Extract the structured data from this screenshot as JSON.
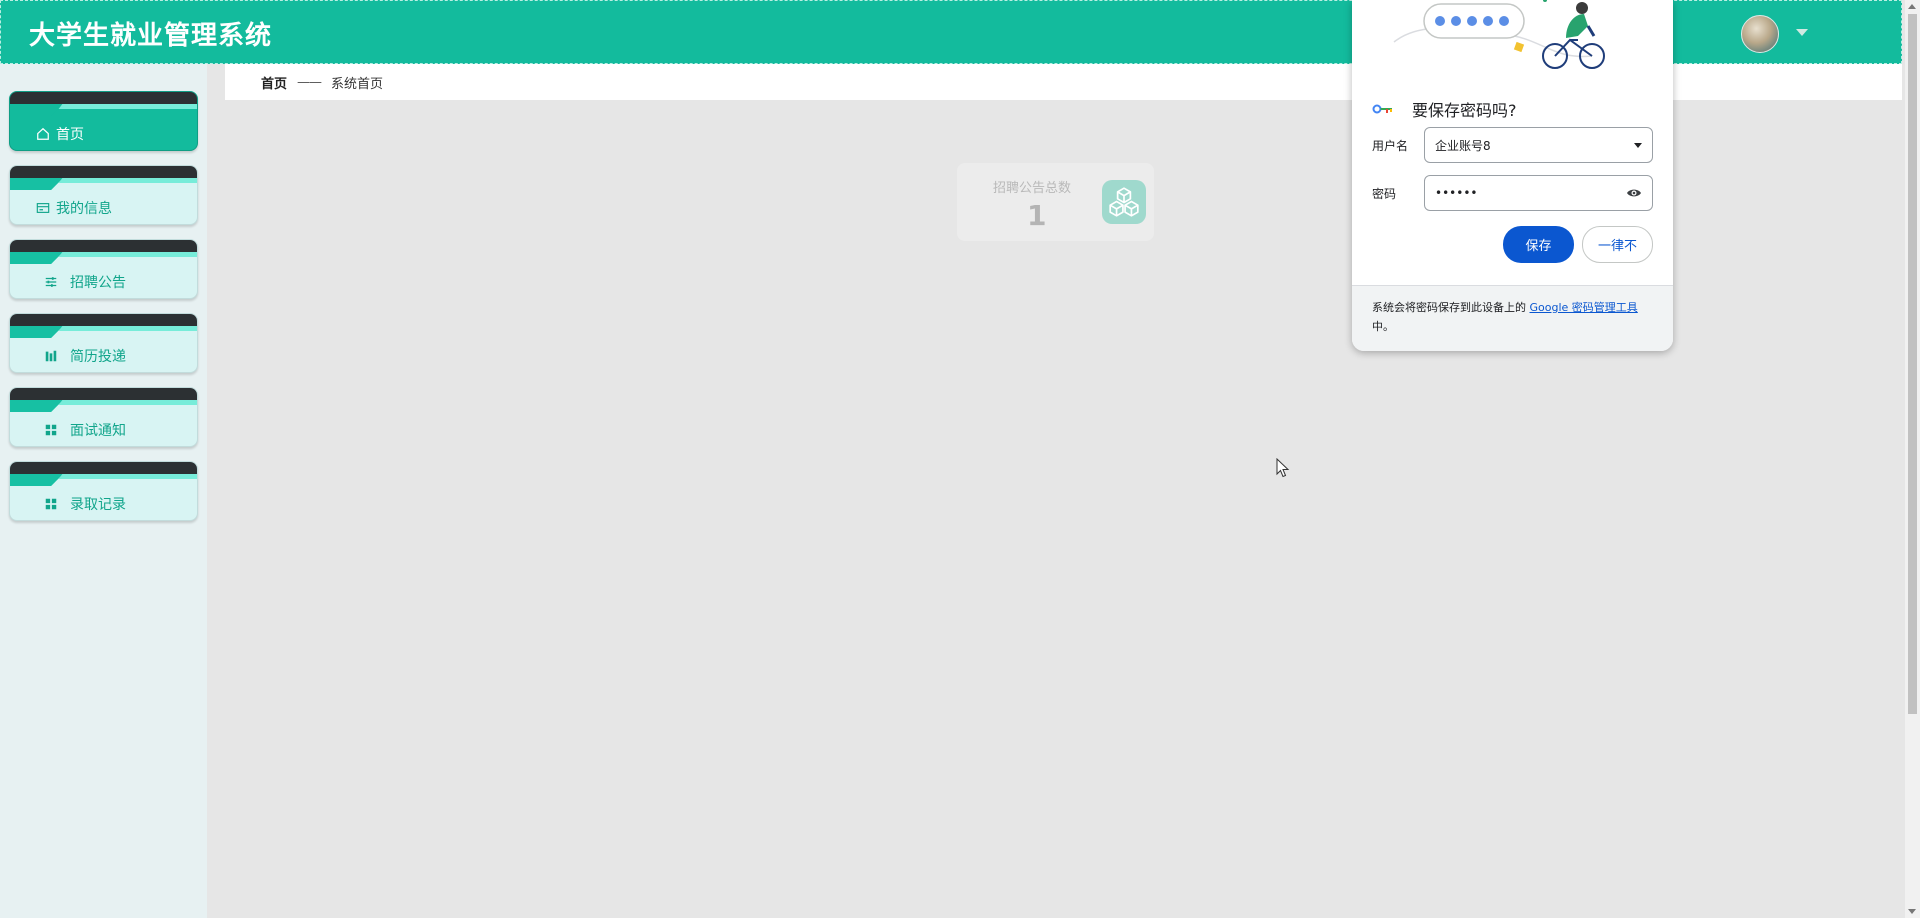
{
  "app": {
    "title": "大学生就业管理系统"
  },
  "header": {
    "avatar_icon": "user-avatar",
    "dropdown_icon": "caret-down-icon"
  },
  "sidebar": {
    "items": [
      {
        "label": "首页",
        "icon": "home-icon",
        "active": true
      },
      {
        "label": "我的信息",
        "icon": "card-icon",
        "active": false
      },
      {
        "label": "招聘公告",
        "icon": "sliders-icon",
        "active": false
      },
      {
        "label": "简历投递",
        "icon": "bar-chart-icon",
        "active": false
      },
      {
        "label": "面试通知",
        "icon": "grid-icon",
        "active": false
      },
      {
        "label": "录取记录",
        "icon": "grid-icon",
        "active": false
      }
    ]
  },
  "breadcrumb": {
    "home": "首页",
    "separator": "——",
    "current": "系统首页"
  },
  "stats": [
    {
      "label": "招聘公告总数",
      "value": "1",
      "icon": "cubes-icon"
    }
  ],
  "password_dialog": {
    "title": "要保存密码吗?",
    "username_label": "用户名",
    "username_value": "企业账号8",
    "password_label": "密码",
    "password_value": "••••••",
    "save_label": "保存",
    "never_label": "一律不",
    "footer_prefix": "系统会将密码保存到此设备上的 ",
    "footer_link": "Google 密码管理工具",
    "footer_suffix": "中。"
  },
  "colors": {
    "primary": "#13bb9d",
    "sidebar_bg": "#e7f1f2",
    "main_bg": "#e6e6e6",
    "chrome_blue": "#0b57d0"
  }
}
